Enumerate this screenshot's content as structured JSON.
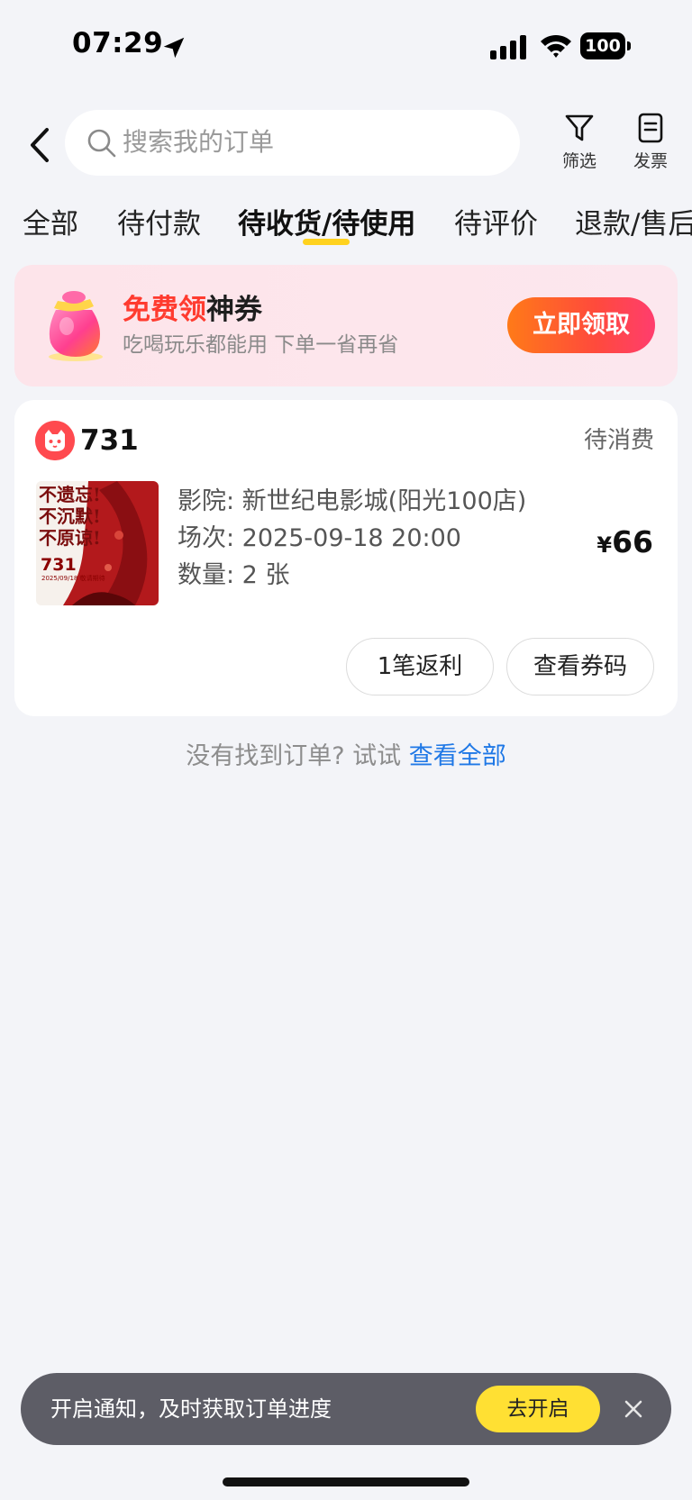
{
  "status_bar": {
    "time": "07:29",
    "battery": "100"
  },
  "header": {
    "search_placeholder": "搜索我的订单",
    "filter_label": "筛选",
    "invoice_label": "发票"
  },
  "tabs": [
    {
      "label": "全部",
      "active": false
    },
    {
      "label": "待付款",
      "active": false
    },
    {
      "label": "待收货/待使用",
      "active": true
    },
    {
      "label": "待评价",
      "active": false
    },
    {
      "label": "退款/售后",
      "active": false
    }
  ],
  "promo": {
    "title_highlight": "免费领",
    "title_rest": "神券",
    "subtitle": "吃喝玩乐都能用 下单一省再省",
    "button_label": "立即领取"
  },
  "order": {
    "shop_name": "731",
    "status": "待消费",
    "poster": {
      "line1": "不遗忘!",
      "line2": "不沉默!",
      "line3": "不原谅!",
      "title": "731",
      "date": "2025/09/18 敬请期待"
    },
    "cinema": "影院: 新世纪电影城(阳光100店)",
    "session": "场次: 2025-09-18 20:00",
    "quantity": "数量: 2 张",
    "price_currency": "¥",
    "price_amount": "66",
    "rebate_button": "1笔返利",
    "voucher_button": "查看券码"
  },
  "not_found": {
    "text": "没有找到订单? 试试 ",
    "link": "查看全部"
  },
  "notification": {
    "text": "开启通知，及时获取订单进度",
    "button_label": "去开启"
  },
  "colors": {
    "accent_yellow": "#ffd21f",
    "promo_red": "#ff3b2f",
    "link_blue": "#1f78e6",
    "shop_logo_red": "#ff4a4f"
  }
}
